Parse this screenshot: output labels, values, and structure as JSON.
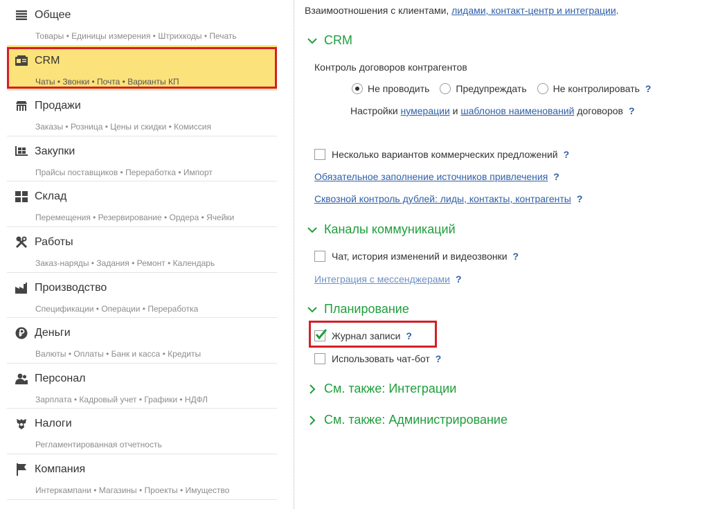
{
  "sidebar": {
    "items": [
      {
        "icon": "list-icon",
        "label": "Общее",
        "sub": "Товары • Единицы измерения • Штрихкоды • Печать"
      },
      {
        "icon": "crm-card-icon",
        "label": "CRM",
        "sub": "Чаты • Звонки • Почта • Варианты КП"
      },
      {
        "icon": "shop-icon",
        "label": "Продажи",
        "sub": "Заказы • Розница • Цены и скидки • Комиссия"
      },
      {
        "icon": "cart-icon",
        "label": "Закупки",
        "sub": "Прайсы поставщиков • Переработка • Импорт"
      },
      {
        "icon": "warehouse-icon",
        "label": "Склад",
        "sub": "Перемещения • Резервирование • Ордера • Ячейки"
      },
      {
        "icon": "tools-icon",
        "label": "Работы",
        "sub": "Заказ-наряды • Задания • Ремонт • Календарь"
      },
      {
        "icon": "factory-icon",
        "label": "Производство",
        "sub": "Спецификации • Операции • Переработка"
      },
      {
        "icon": "ruble-coin-icon",
        "label": "Деньги",
        "sub": "Валюты • Оплаты • Банк и касса • Кредиты"
      },
      {
        "icon": "people-icon",
        "label": "Персонал",
        "sub": "Зарплата • Кадровый учет • Графики • НДФЛ"
      },
      {
        "icon": "eagle-emblem-icon",
        "label": "Налоги",
        "sub": "Регламентированная отчетность"
      },
      {
        "icon": "flag-icon",
        "label": "Компания",
        "sub": "Интеркампани • Магазины • Проекты • Имущество"
      }
    ]
  },
  "main": {
    "intro_text": "Взаимоотношения с клиентами,",
    "intro_link": "лидами, контакт-центр и интеграции",
    "intro_end": ".",
    "crm": {
      "title": "CRM",
      "contract_control_label": "Контроль договоров контрагентов",
      "radio_options": [
        "Не проводить",
        "Предупреждать",
        "Не контролировать"
      ],
      "selected": "Не проводить",
      "settings_text": "Настройки",
      "numbering_link": "нумерации",
      "and_text": "и",
      "templates_link": "шаблонов наименований",
      "contracts_text": "договоров",
      "multi_proposals_label": "Несколько вариантов коммерческих предложений",
      "sources_link": "Обязательное заполнение источников привлечения",
      "duplicates_link": "Сквозной контроль дублей: лиды, контакты, контрагенты"
    },
    "channels": {
      "title": "Каналы коммуникаций",
      "chat_label": "Чат, история изменений и видеозвонки",
      "messengers_link": "Интеграция с мессенджерами"
    },
    "planning": {
      "title": "Планирование",
      "journal_label": "Журнал записи",
      "journal_checked": true,
      "chatbot_label": "Использовать чат-бот",
      "chatbot_checked": false
    },
    "see_also_integrations": "См. также: Интеграции",
    "see_also_admin": "См. также: Администрирование",
    "help_mark": "?"
  },
  "colors": {
    "accent_green": "#1f9e3b",
    "link_blue": "#2e5fa8",
    "highlight_yellow": "#fbe27a",
    "frame_red": "#d41f26"
  }
}
